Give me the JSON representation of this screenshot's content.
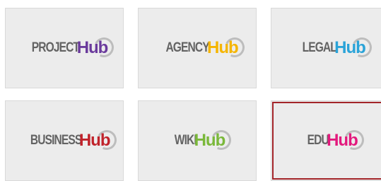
{
  "tiles": [
    {
      "prefix": "PROJECT",
      "suffix": "Hub",
      "hub_color": "#6a3a9c",
      "selected": false
    },
    {
      "prefix": "AGENCY",
      "suffix": "Hub",
      "hub_color": "#f5b500",
      "selected": false
    },
    {
      "prefix": "LEGAL",
      "suffix": "Hub",
      "hub_color": "#2aa3d8",
      "selected": false
    },
    {
      "prefix": "BUSINESS",
      "suffix": "Hub",
      "hub_color": "#c0232b",
      "selected": false
    },
    {
      "prefix": "WIKI",
      "suffix": "Hub",
      "hub_color": "#7ab83a",
      "selected": false
    },
    {
      "prefix": "EDU",
      "suffix": "Hub",
      "hub_color": "#e3197d",
      "selected": true
    }
  ],
  "colors": {
    "tile_background": "#ececec",
    "wordmark_gray": "#636363",
    "selection_border": "#a3252a",
    "ring_gray": "#bdbdbd"
  },
  "icon_names": [
    "hub-ring-icon"
  ]
}
